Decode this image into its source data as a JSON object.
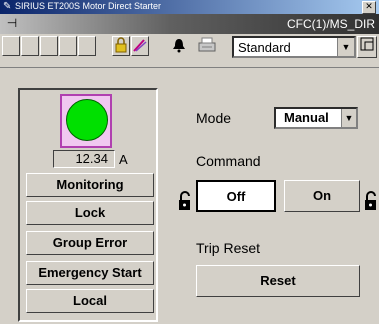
{
  "window": {
    "title": "SIRIUS ET200S Motor Direct Starter",
    "close_glyph": "✕",
    "path": "CFC(1)/MS_DIR"
  },
  "toolbar": {
    "view_select": "Standard",
    "icons": [
      "pin-icon",
      "lock-icon",
      "edit-icon",
      "bell-icon",
      "print-icon",
      "resize-icon"
    ]
  },
  "status": {
    "led_color": "#00e000",
    "current_value": "12.34",
    "current_unit": "A",
    "buttons": [
      "Monitoring",
      "Lock",
      "Group Error",
      "Emergency Start",
      "Local"
    ]
  },
  "control": {
    "mode_label": "Mode",
    "mode_value": "Manual",
    "command_label": "Command",
    "off_label": "Off",
    "on_label": "On",
    "trip_reset_label": "Trip Reset",
    "reset_label": "Reset"
  }
}
